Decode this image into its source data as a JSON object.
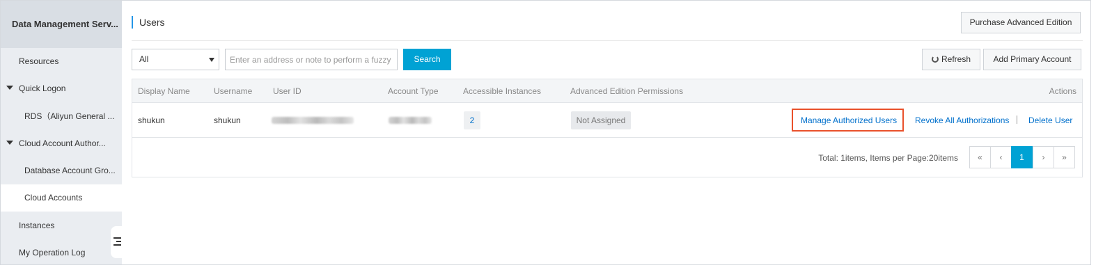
{
  "sidebar": {
    "title": "Data Management Serv...",
    "items": [
      {
        "label": "Resources"
      },
      {
        "label": "Quick Logon"
      },
      {
        "label": "RDS（Aliyun General ..."
      },
      {
        "label": "Cloud Account Author..."
      },
      {
        "label": "Database Account Gro..."
      },
      {
        "label": "Cloud Accounts"
      },
      {
        "label": "Instances"
      },
      {
        "label": "My Operation Log"
      }
    ],
    "collapse_icon": "collapse-sidebar-icon"
  },
  "header": {
    "title": "Users",
    "purchase_label": "Purchase Advanced Edition"
  },
  "toolbar": {
    "filter_selected": "All",
    "search_placeholder": "Enter an address or note to perform a fuzzy search",
    "search_label": "Search",
    "refresh_label": "Refresh",
    "add_label": "Add Primary Account"
  },
  "table": {
    "columns": [
      "Display Name",
      "Username",
      "User ID",
      "Account Type",
      "Accessible Instances",
      "Advanced Edition Permissions",
      "Actions"
    ],
    "rows": [
      {
        "display_name": "shukun",
        "username": "shukun",
        "accessible_instances": "2",
        "permission": "Not Assigned",
        "actions": [
          "Manage Authorized Users",
          "Revoke All Authorizations",
          "Delete User"
        ]
      }
    ]
  },
  "pagination": {
    "summary": "Total: 1items,   Items per Page:20items",
    "first": "«",
    "prev": "‹",
    "current": "1",
    "next": "›",
    "last": "»"
  },
  "colors": {
    "accent": "#00a2d4",
    "link": "#0070cc",
    "highlight": "#e9512b"
  }
}
